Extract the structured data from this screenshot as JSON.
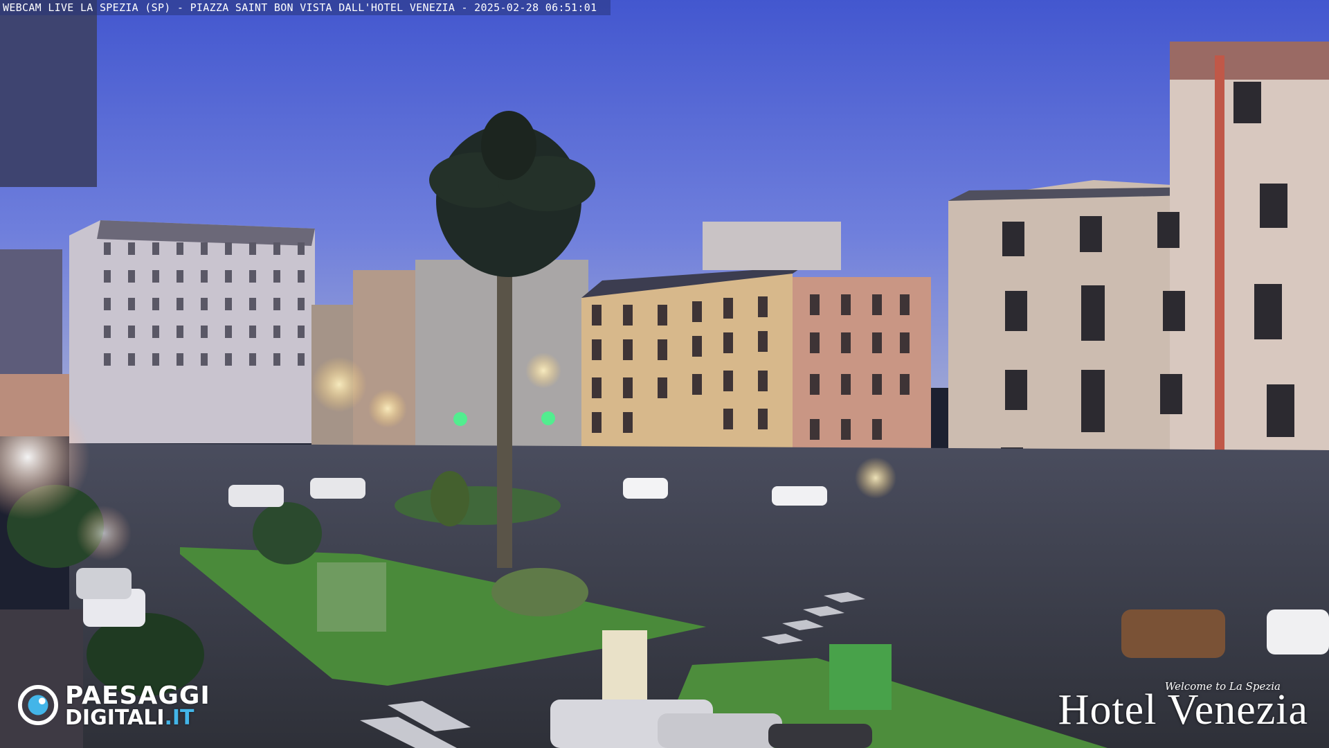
{
  "overlay": {
    "caption": "WEBCAM LIVE LA SPEZIA (SP) - PIAZZA SAINT BON VISTA DALL'HOTEL VENEZIA - 2025-02-28 06:51:01"
  },
  "watermark_left": {
    "line1": "PAESAGGI",
    "line2_main": "DIGITALI",
    "line2_tld": ".IT",
    "icon": "paesaggi-logo-icon"
  },
  "watermark_right": {
    "welcome": "Welcome to La Spezia",
    "name": "Hotel Venezia"
  },
  "colors": {
    "sky_top": "#4a5fd1",
    "sky_bottom": "#8a96d8",
    "grass": "#4a8a3a",
    "road": "#3a3d48",
    "accent_blue": "#43b5e8"
  }
}
